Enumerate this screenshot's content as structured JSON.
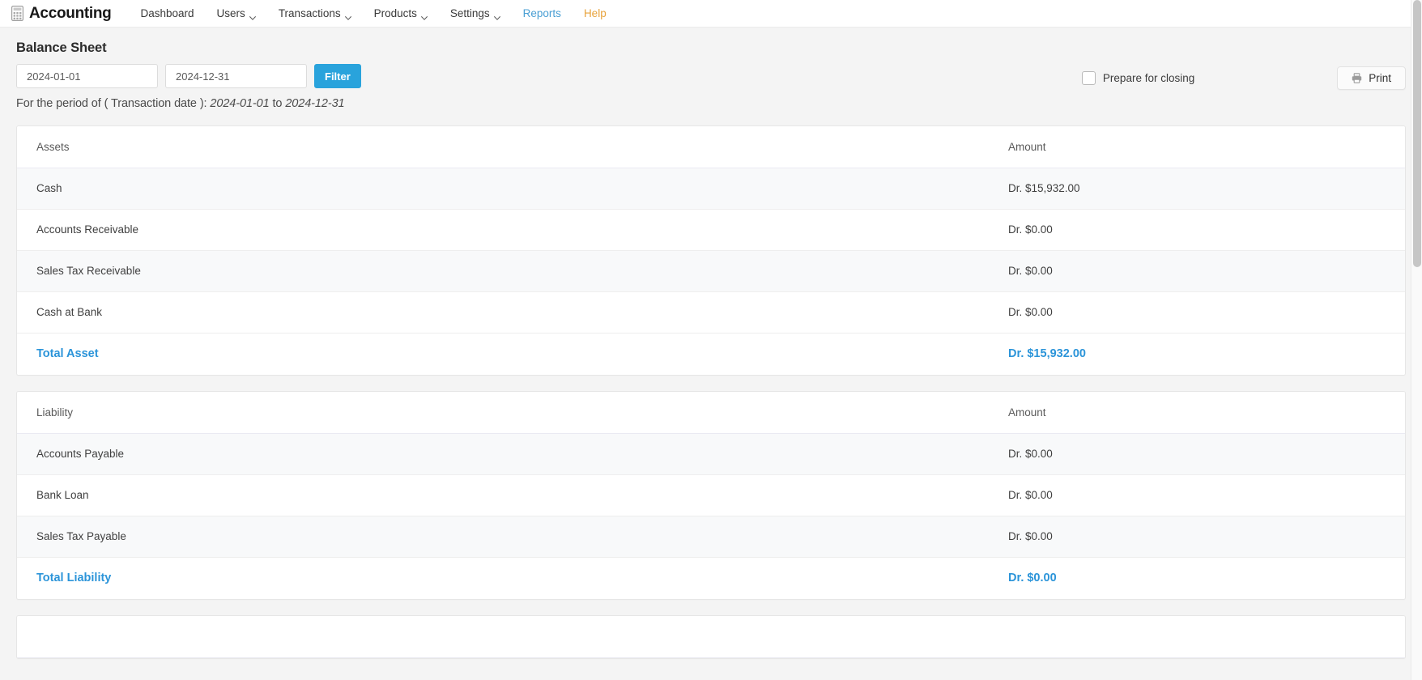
{
  "navbar": {
    "brand_icon": "calculator-icon",
    "brand": "Accounting",
    "items": [
      {
        "label": "Dashboard",
        "has_caret": false,
        "style": "default"
      },
      {
        "label": "Users",
        "has_caret": true,
        "style": "default"
      },
      {
        "label": "Transactions",
        "has_caret": true,
        "style": "default"
      },
      {
        "label": "Products",
        "has_caret": true,
        "style": "default"
      },
      {
        "label": "Settings",
        "has_caret": true,
        "style": "default"
      },
      {
        "label": "Reports",
        "has_caret": false,
        "style": "reports"
      },
      {
        "label": "Help",
        "has_caret": false,
        "style": "help"
      }
    ]
  },
  "page": {
    "title": "Balance Sheet",
    "period_prefix": "For the period of ( Transaction date ): ",
    "period_from": "2024-01-01",
    "period_join": " to ",
    "period_to": "2024-12-31"
  },
  "filters": {
    "date_from": {
      "value": "2024-01-01",
      "placeholder": "2024-01-01"
    },
    "date_to": {
      "value": "2024-12-31",
      "placeholder": "2024-12-31"
    },
    "filter_button": "Filter",
    "prepare_for_closing": {
      "label": "Prepare for closing",
      "checked": false
    },
    "print_button": {
      "label": "Print",
      "icon": "printer-icon"
    }
  },
  "colors": {
    "accent_blue": "#29a3dc",
    "total_blue": "#2b94d9",
    "reports_link": "#4a9fd4",
    "help_link": "#e8a33d",
    "page_bg": "#f4f4f4",
    "card_bg": "#ffffff",
    "stripe_bg": "#f8f9fa"
  },
  "sections": [
    {
      "headers": {
        "name": "Assets",
        "amount": "Amount"
      },
      "rows": [
        {
          "name": "Cash",
          "amount": "Dr. $15,932.00"
        },
        {
          "name": "Accounts Receivable",
          "amount": "Dr. $0.00"
        },
        {
          "name": "Sales Tax Receivable",
          "amount": "Dr. $0.00"
        },
        {
          "name": "Cash at Bank",
          "amount": "Dr. $0.00"
        }
      ],
      "total": {
        "name": "Total Asset",
        "amount": "Dr. $15,932.00"
      }
    },
    {
      "headers": {
        "name": "Liability",
        "amount": "Amount"
      },
      "rows": [
        {
          "name": "Accounts Payable",
          "amount": "Dr. $0.00"
        },
        {
          "name": "Bank Loan",
          "amount": "Dr. $0.00"
        },
        {
          "name": "Sales Tax Payable",
          "amount": "Dr. $0.00"
        }
      ],
      "total": {
        "name": "Total Liability",
        "amount": "Dr. $0.00"
      }
    },
    {
      "headers": {
        "name": "",
        "amount": ""
      },
      "rows": [],
      "total": null
    }
  ]
}
